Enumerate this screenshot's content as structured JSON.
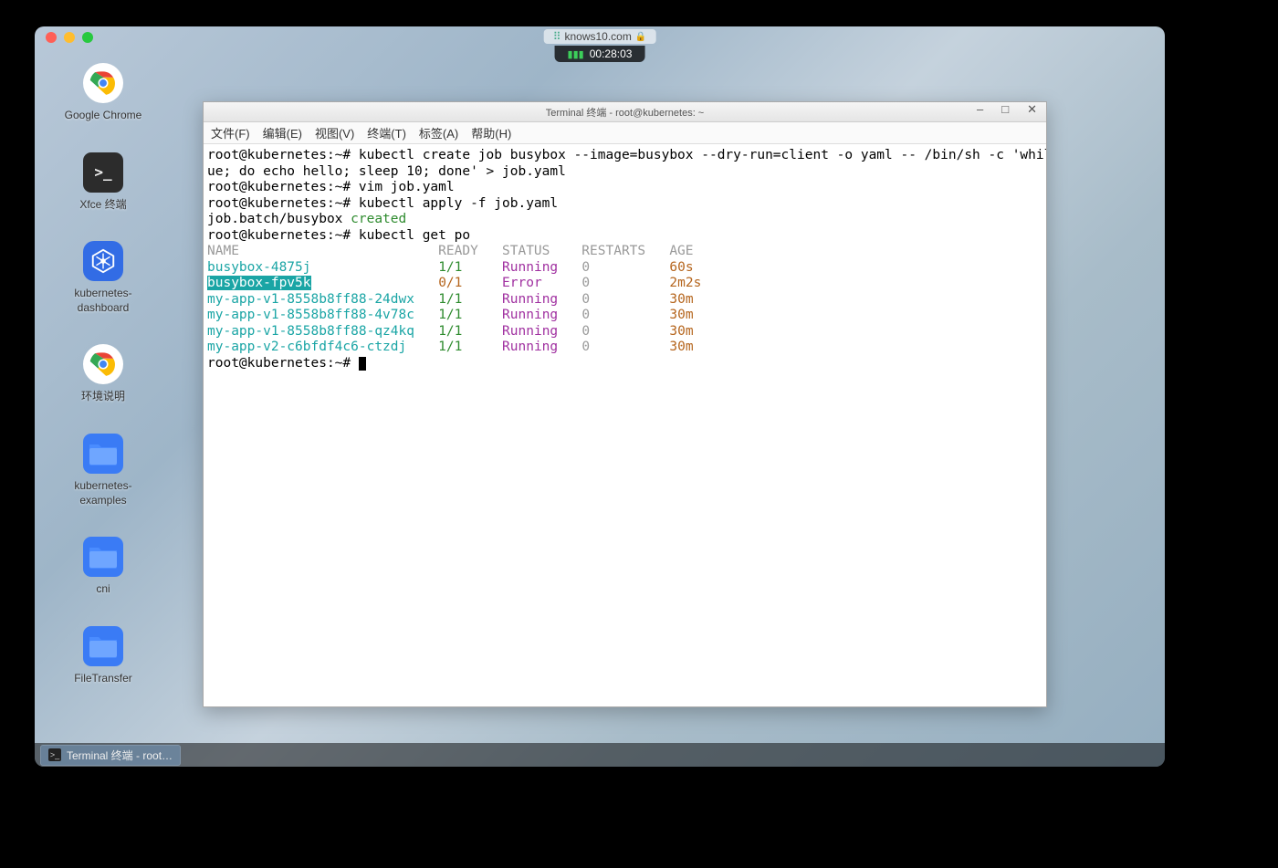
{
  "urlbar": {
    "domain": "knows10.com"
  },
  "timer": "00:28:03",
  "desktop": {
    "items": [
      {
        "label": "Google Chrome",
        "icon": "chrome"
      },
      {
        "label": "Xfce 终端",
        "icon": "xfce"
      },
      {
        "label": "kubernetes-dashboard",
        "icon": "k8s"
      },
      {
        "label": "环境说明",
        "icon": "chrome"
      },
      {
        "label": "kubernetes-examples",
        "icon": "folder"
      },
      {
        "label": "cni",
        "icon": "folder"
      },
      {
        "label": "FileTransfer",
        "icon": "folder"
      }
    ]
  },
  "terminal": {
    "title": "Terminal 终端 - root@kubernetes: ~",
    "menu": [
      "文件(F)",
      "编辑(E)",
      "视图(V)",
      "终端(T)",
      "标签(A)",
      "帮助(H)"
    ],
    "prompt": "root@kubernetes:~#",
    "lines": {
      "cmd1a": "root@kubernetes:~# kubectl create job busybox --image=busybox --dry-run=client -o yaml -- /bin/sh -c 'while tr",
      "cmd1b": "ue; do echo hello; sleep 10; done' > job.yaml",
      "cmd2": "root@kubernetes:~# vim job.yaml",
      "cmd3": "root@kubernetes:~# kubectl apply -f job.yaml",
      "result3a": "job.batch/busybox ",
      "result3b": "created",
      "cmd4": "root@kubernetes:~# kubectl get po",
      "headers": {
        "name": "NAME",
        "ready": "READY",
        "status": "STATUS",
        "restarts": "RESTARTS",
        "age": "AGE"
      },
      "pods": [
        {
          "name": "busybox-4875j",
          "ready": "1/1",
          "status": "Running",
          "restarts": "0",
          "age": "60s",
          "hl": false,
          "err": false
        },
        {
          "name": "busybox-fpv5k",
          "ready": "0/1",
          "status": "Error",
          "restarts": "0",
          "age": "2m2s",
          "hl": true,
          "err": true
        },
        {
          "name": "my-app-v1-8558b8ff88-24dwx",
          "ready": "1/1",
          "status": "Running",
          "restarts": "0",
          "age": "30m",
          "hl": false,
          "err": false
        },
        {
          "name": "my-app-v1-8558b8ff88-4v78c",
          "ready": "1/1",
          "status": "Running",
          "restarts": "0",
          "age": "30m",
          "hl": false,
          "err": false
        },
        {
          "name": "my-app-v1-8558b8ff88-qz4kq",
          "ready": "1/1",
          "status": "Running",
          "restarts": "0",
          "age": "30m",
          "hl": false,
          "err": false
        },
        {
          "name": "my-app-v2-c6bfdf4c6-ctzdj",
          "ready": "1/1",
          "status": "Running",
          "restarts": "0",
          "age": "30m",
          "hl": false,
          "err": false
        }
      ],
      "last_prompt": "root@kubernetes:~# "
    }
  },
  "taskbar": {
    "items": [
      {
        "label": "Terminal 终端 - root…"
      }
    ]
  }
}
